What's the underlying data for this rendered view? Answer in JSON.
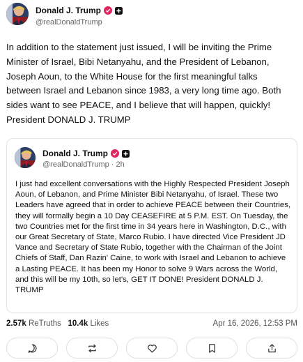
{
  "post": {
    "author_name": "Donald J. Trump",
    "handle": "@realDonaldTrump",
    "text": "In addition to the statement just issued, I will be inviting the Prime Minister of Israel, Bibi Netanyahu, and the President of Lebanon, Joseph Aoun, to the White House for the first meaningful talks between Israel and Lebanon since 1983, a very long time ago. Both sides want to see PEACE, and I believe that will happen, quickly! President DONALD J. TRUMP"
  },
  "quote": {
    "author_name": "Donald J. Trump",
    "handle_time": "@realDonaldTrump · 2h",
    "text": "I just had excellent conversations with the Highly Respected President Joseph Aoun, of Lebanon, and Prime Minister Bibi Netanyahu, of Israel. These two Leaders have agreed that in order to achieve PEACE between their Countries, they will formally begin a 10 Day CEASEFIRE at 5 P.M. EST. On Tuesday, the two Countries met for the first time in 34 years here in Washington, D.C., with our Great Secretary of State, Marco Rubio. I have directed Vice President JD Vance and Secretary of State Rubio, together with the Chairman of the Joint Chiefs of Staff, Dan Razin' Caine, to work with Israel and Lebanon to achieve a Lasting PEACE. It has been my Honor to solve 9 Wars across the World, and this will be my 10th, so let's, GET IT DONE! President DONALD J. TRUMP"
  },
  "stats": {
    "retruths_count": "2.57k",
    "retruths_label": "ReTruths",
    "likes_count": "10.4k",
    "likes_label": "Likes",
    "timestamp": "Apr 16, 2026, 12:53 PM"
  },
  "actions": {
    "icons": [
      "reply-icon",
      "retruth-icon",
      "like-icon",
      "bookmark-icon",
      "share-icon"
    ]
  },
  "colors": {
    "verified_badge": "#e0245e",
    "secondary_text": "#666666",
    "border": "#e2e2e2"
  }
}
